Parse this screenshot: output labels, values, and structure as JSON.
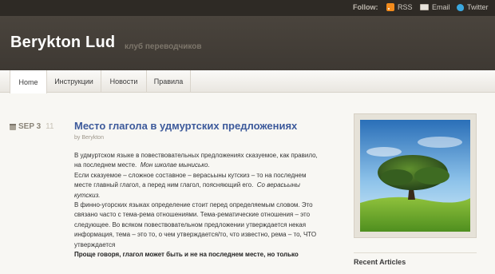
{
  "topbar": {
    "follow_label": "Follow:",
    "rss_label": "RSS",
    "email_label": "Email",
    "twitter_label": "Twitter",
    "icons": [
      "rss-icon",
      "email-icon",
      "twitter-icon"
    ]
  },
  "header": {
    "site_title": "Berykton Lud",
    "tagline": "клуб переводчиков"
  },
  "nav": {
    "items": [
      {
        "label": "Home",
        "active": true
      },
      {
        "label": "Инструкции"
      },
      {
        "label": "Новости"
      },
      {
        "label": "Правила"
      }
    ]
  },
  "post": {
    "date": "SEP 3",
    "comment_count": "11",
    "title": "Место глагола в удмуртских предложениях",
    "byline": "by Berykton",
    "p1_text": "В удмуртском языке в повествовательных предложениях сказуемое, как правило, на последнем месте.",
    "p1_example": "Мон школае мыниськo.",
    "p2_text": "Если сказуемое – сложное составное – верасьыны кутскиз – то на последнем месте главный глагол, а перед ним глагол, поясняющий его.",
    "p2_example": "Со верасьыны кутскиз.",
    "p3": "В финно-угорских языках определение стоит перед определяемым словом.  Это связано часто с тема-рема отношениями. Тема-рематические отношения – это следующее. Во всяком повествовательном предложении утверждается некая информация, тема – это то, о чем утверждается/то, что известно, рема – то, ЧТО утверждается",
    "p4_bold": "Проще говоря, глагол может быть и не на последнем месте, но только"
  },
  "sidebar": {
    "recent_heading": "Recent Articles"
  },
  "colors": {
    "topbar_bg": "#2e2a25",
    "header_bg": "#433e37",
    "title_link": "#3d5a9b",
    "page_bg": "#f7f6f2"
  }
}
